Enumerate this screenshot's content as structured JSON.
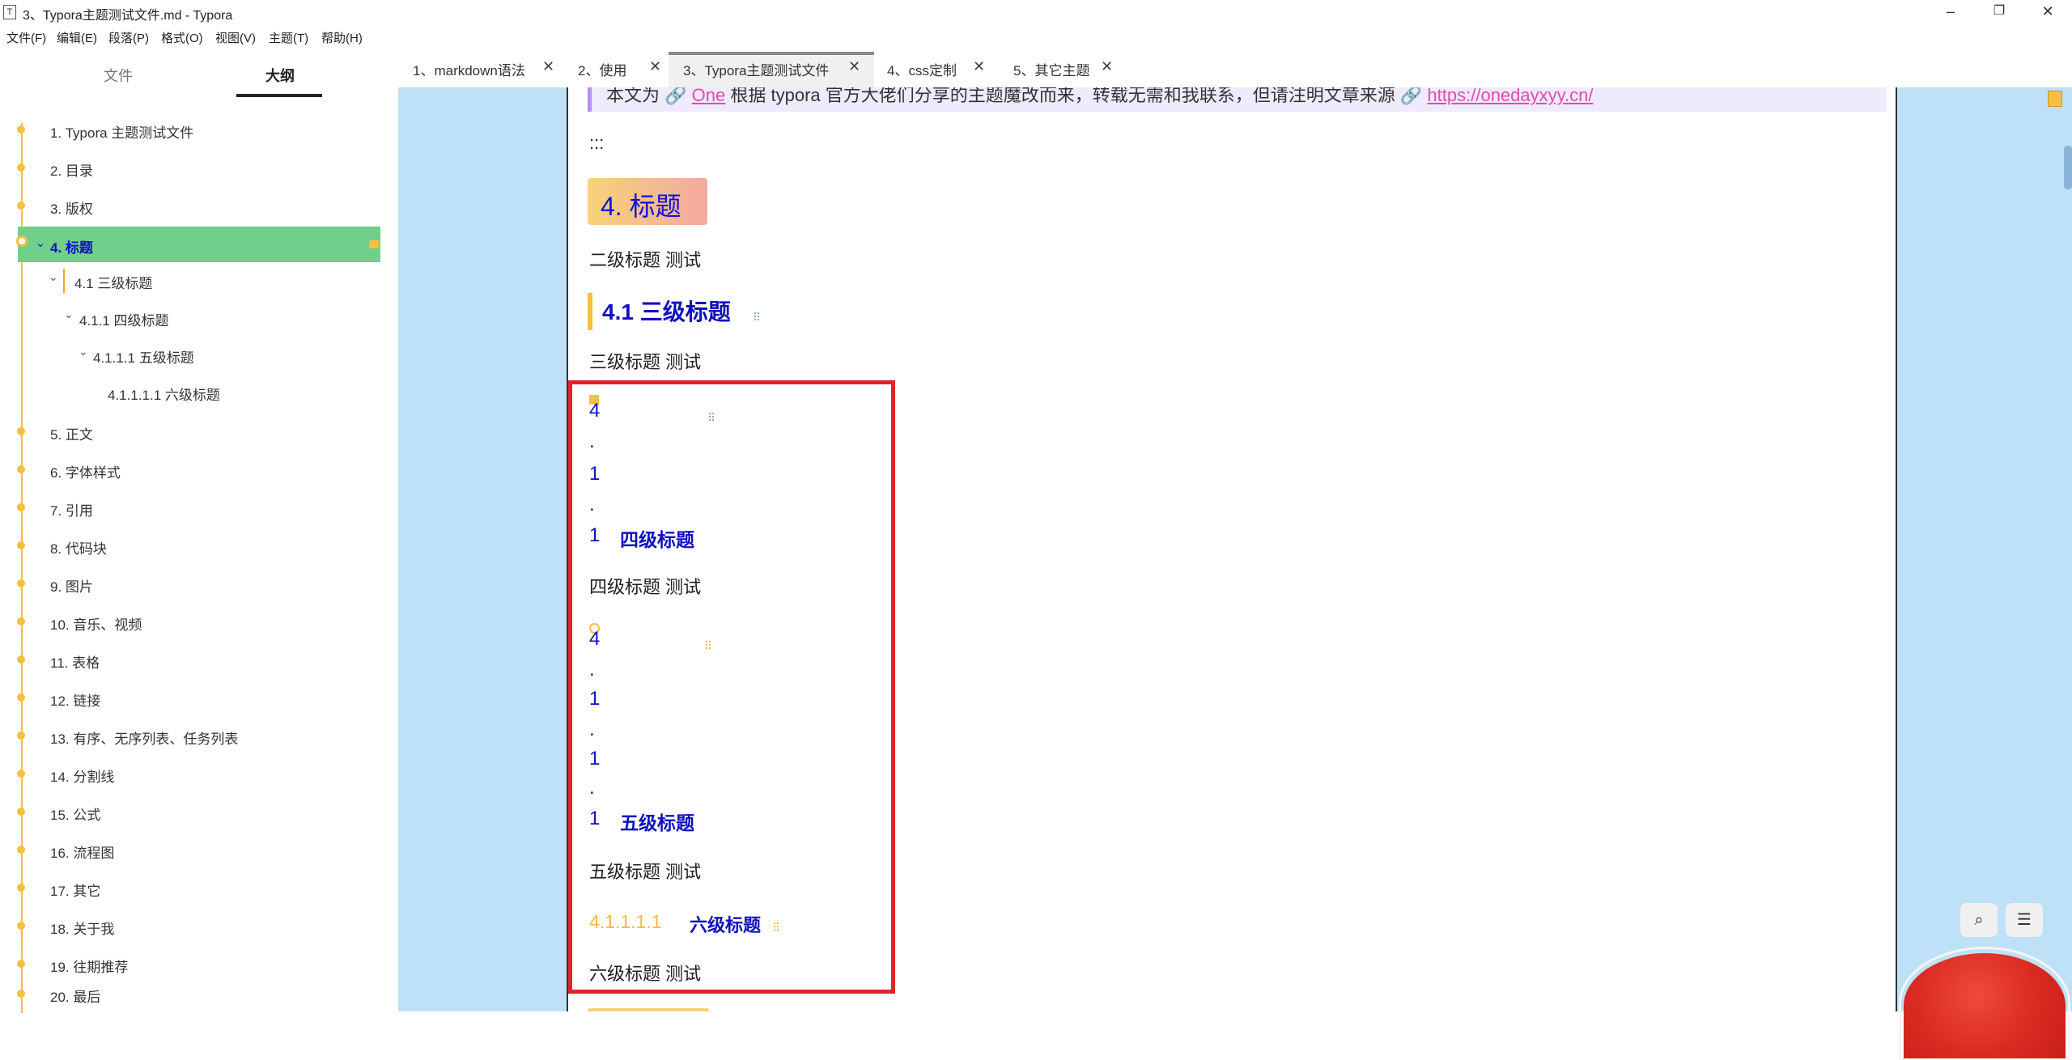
{
  "window": {
    "title": "3、Typora主题测试文件.md - Typora",
    "app_icon": "T",
    "minimize": "–",
    "maximize": "❐",
    "close": "✕"
  },
  "menu": [
    "文件(F)",
    "编辑(E)",
    "段落(P)",
    "格式(O)",
    "视图(V)",
    "主题(T)",
    "帮助(H)"
  ],
  "sidebar": {
    "tabs": [
      "文件",
      "大纲"
    ],
    "active_tab": "大纲",
    "outline": [
      {
        "label": "1. Typora 主题测试文件"
      },
      {
        "label": "2. 目录"
      },
      {
        "label": "3. 版权"
      },
      {
        "label": "4. 标题"
      },
      {
        "label": "4.1 三级标题"
      },
      {
        "label": "4.1.1 四级标题"
      },
      {
        "label": "4.1.1.1 五级标题"
      },
      {
        "label": "4.1.1.1.1 六级标题"
      },
      {
        "label": "5. 正文"
      },
      {
        "label": "6. 字体样式"
      },
      {
        "label": "7. 引用"
      },
      {
        "label": "8. 代码块"
      },
      {
        "label": "9. 图片"
      },
      {
        "label": "10. 音乐、视频"
      },
      {
        "label": "11. 表格"
      },
      {
        "label": "12. 链接"
      },
      {
        "label": "13. 有序、无序列表、任务列表"
      },
      {
        "label": "14. 分割线"
      },
      {
        "label": "15. 公式"
      },
      {
        "label": "16. 流程图"
      },
      {
        "label": "17. 其它"
      },
      {
        "label": "18. 关于我"
      },
      {
        "label": "19. 往期推荐"
      },
      {
        "label": "20. 最后"
      }
    ],
    "active_item": "4. 标题"
  },
  "tabs": [
    {
      "label": "1、markdown语法",
      "close": "✕"
    },
    {
      "label": "2、使用",
      "close": "✕"
    },
    {
      "label": "3、Typora主题测试文件",
      "close": "✕",
      "active": true
    },
    {
      "label": "4、css定制",
      "close": "✕"
    },
    {
      "label": "5、其它主题",
      "close": "✕"
    }
  ],
  "editor": {
    "quote_prefix": "本文为",
    "quote_link1": "One",
    "quote_middle": "根据 typora 官方大佬们分享的主题魔改而来，转载无需和我联系，但请注明文章来源",
    "quote_link2": "https://onedayxyy.cn/",
    "separator": ":::",
    "h2": "4. 标题",
    "p_h2": "二级标题 测试",
    "h3": "4.1  三级标题",
    "p_h3": "三级标题 测试",
    "h4_chars": [
      "4",
      ".",
      "1",
      ".",
      "1"
    ],
    "h4_title": "四级标题",
    "p_h4": "四级标题 测试",
    "h5_chars": [
      "4",
      ".",
      "1",
      ".",
      "1",
      ".",
      "1"
    ],
    "h5_title": "五级标题",
    "p_h5": "五级标题 测试",
    "h6_num": "4.1.1.1.1",
    "h6_title": "六级标题",
    "p_h6": "六级标题 测试"
  },
  "tools": {
    "search": "⌕",
    "menu": "☰"
  },
  "colors": {
    "accent_yellow": "#f5c040",
    "active_outline_bg": "#6fcf8b",
    "heading_blue": "#1010c0",
    "highlight_red": "#e0242c",
    "editor_bg": "#bfe1f7"
  }
}
